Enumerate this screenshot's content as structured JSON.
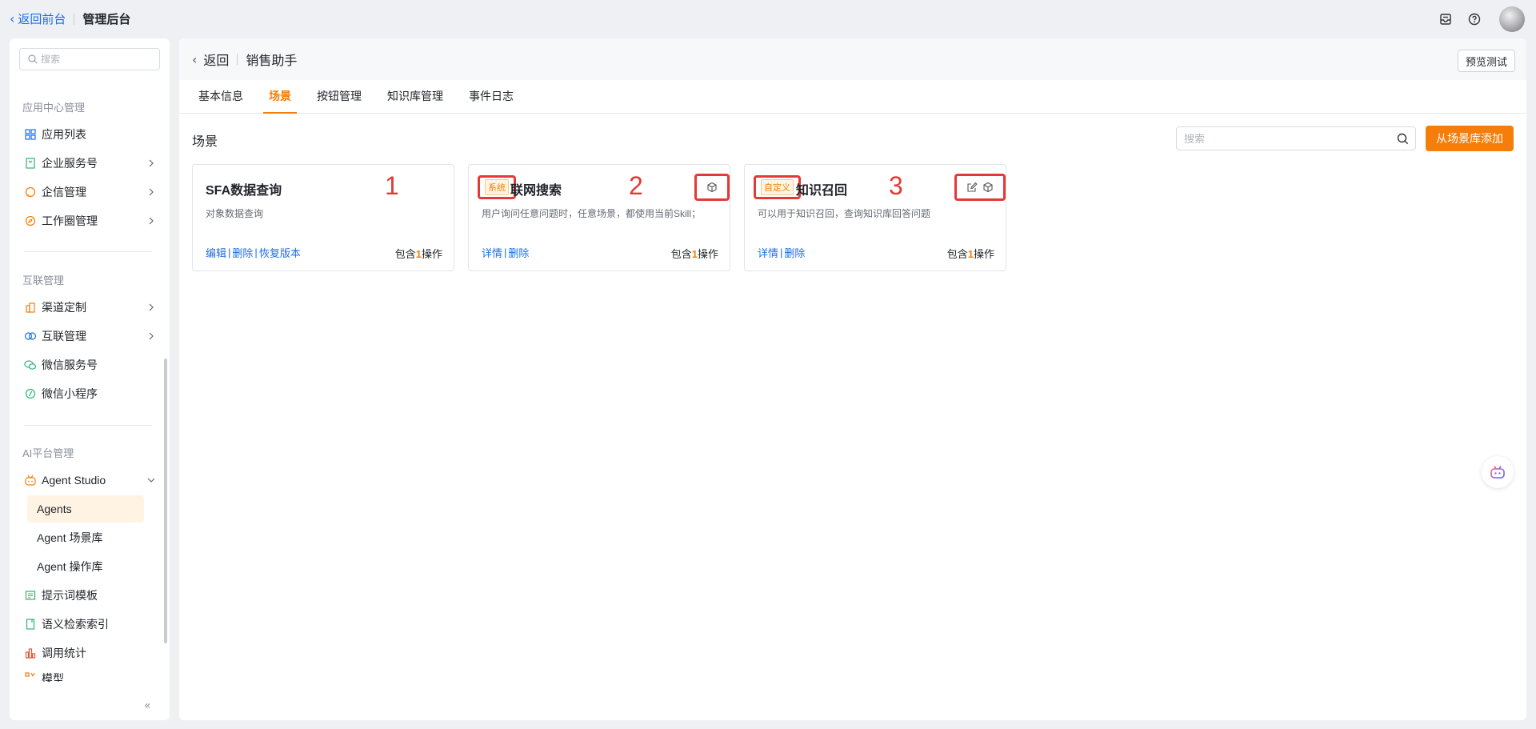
{
  "topbar": {
    "back_label": "返回前台",
    "title": "管理后台",
    "icons": [
      "inbox-icon",
      "help-icon",
      "avatar"
    ]
  },
  "sidebar": {
    "search_placeholder": "搜索",
    "groups": [
      {
        "label": "应用中心管理",
        "items": [
          {
            "label": "应用列表",
            "icon": "grid-icon",
            "expandable": false
          },
          {
            "label": "企业服务号",
            "icon": "bookmark-icon",
            "expandable": true
          },
          {
            "label": "企信管理",
            "icon": "chat-icon",
            "expandable": true
          },
          {
            "label": "工作圈管理",
            "icon": "compass-icon",
            "expandable": true
          }
        ]
      },
      {
        "label": "互联管理",
        "items": [
          {
            "label": "渠道定制",
            "icon": "building-icon",
            "expandable": true
          },
          {
            "label": "互联管理",
            "icon": "link-icon",
            "expandable": true
          },
          {
            "label": "微信服务号",
            "icon": "wechat-icon",
            "expandable": false
          },
          {
            "label": "微信小程序",
            "icon": "miniprogram-icon",
            "expandable": false
          }
        ]
      },
      {
        "label": "AI平台管理",
        "items": [
          {
            "label": "Agent Studio",
            "icon": "robot-icon",
            "expanded": true
          },
          {
            "label": "Agents",
            "active": true
          },
          {
            "label": "Agent 场景库"
          },
          {
            "label": "Agent 操作库"
          },
          {
            "label": "提示词模板",
            "icon": "template-icon"
          },
          {
            "label": "语义检索索引",
            "icon": "index-icon"
          },
          {
            "label": "调用统计",
            "icon": "stats-icon"
          },
          {
            "label": "模型",
            "icon": "model-icon"
          }
        ]
      }
    ]
  },
  "header": {
    "back_label": "返回",
    "title": "销售助手",
    "preview_label": "预览测试"
  },
  "tabs": [
    {
      "label": "基本信息",
      "active": false
    },
    {
      "label": "场景",
      "active": true
    },
    {
      "label": "按钮管理",
      "active": false
    },
    {
      "label": "知识库管理",
      "active": false
    },
    {
      "label": "事件日志",
      "active": false
    }
  ],
  "content": {
    "section_title": "场景",
    "search_placeholder": "搜索",
    "add_button": "从场景库添加"
  },
  "cards": [
    {
      "number": "1",
      "badge": "",
      "title": "SFA数据查询",
      "desc": "对象数据查询",
      "actions": [
        "编辑",
        "删除",
        "恢复版本"
      ],
      "count_prefix": "包含",
      "count": "1",
      "count_suffix": "操作"
    },
    {
      "number": "2",
      "badge": "系统",
      "title": "联网搜索",
      "desc": "用户询问任意问题时，任意场景，都使用当前Skill；",
      "actions": [
        "详情",
        "删除"
      ],
      "count_prefix": "包含",
      "count": "1",
      "count_suffix": "操作"
    },
    {
      "number": "3",
      "badge": "自定义",
      "title": "知识召回",
      "desc": "可以用于知识召回，查询知识库回答问题",
      "actions": [
        "详情",
        "删除"
      ],
      "count_prefix": "包含",
      "count": "1",
      "count_suffix": "操作"
    }
  ],
  "colors": {
    "accent": "#f57d0a",
    "link": "#1a6fe8",
    "highlight": "#e53935"
  }
}
